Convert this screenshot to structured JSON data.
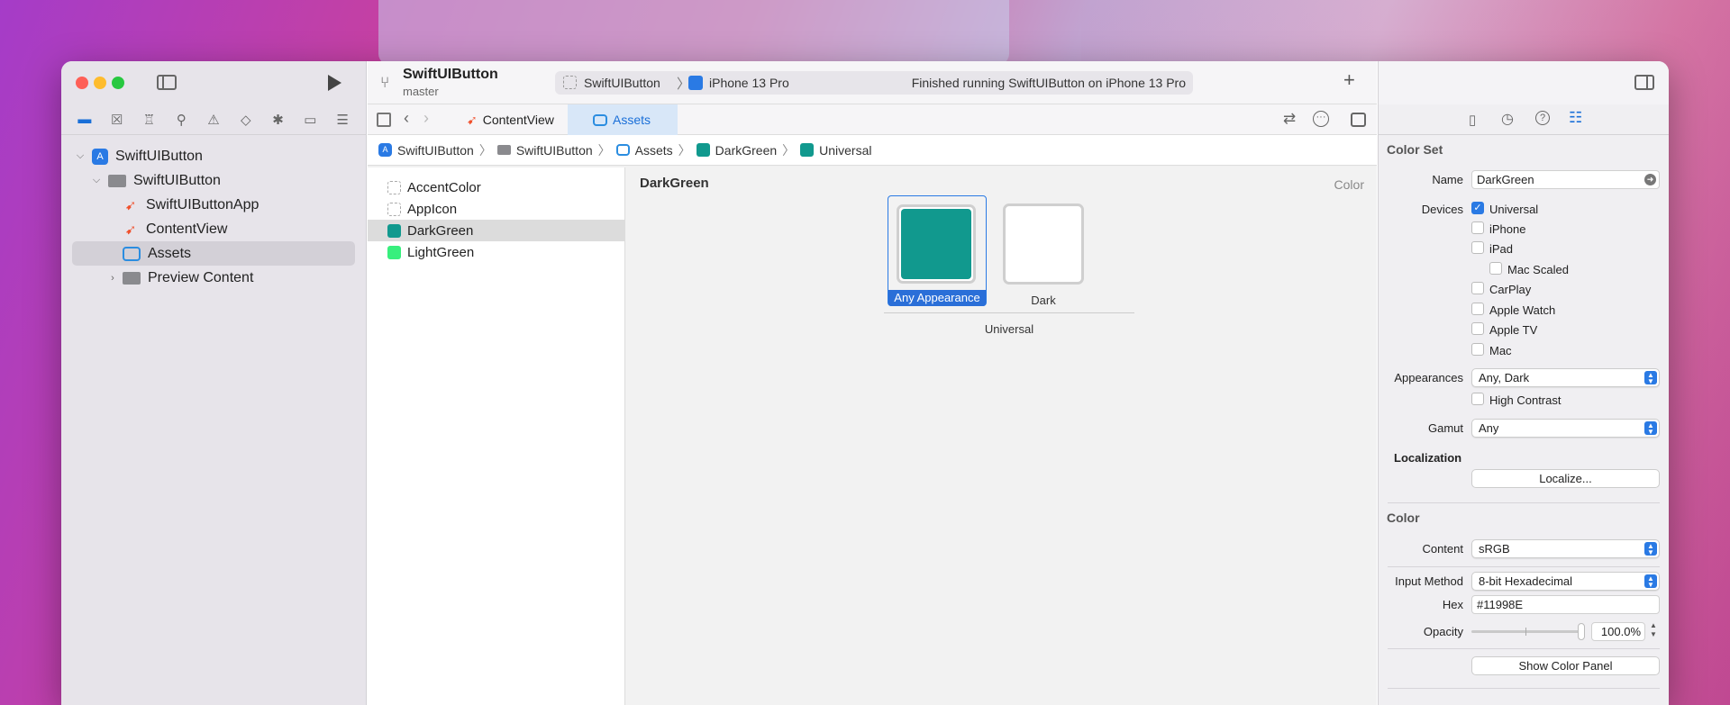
{
  "project": {
    "name": "SwiftUIButton",
    "branch": "master"
  },
  "toolbar": {
    "scheme": "SwiftUIButton",
    "device": "iPhone 13 Pro",
    "status": "Finished running SwiftUIButton on iPhone 13 Pro"
  },
  "navigator": {
    "items": [
      {
        "label": "SwiftUIButton",
        "icon": "app-icon"
      },
      {
        "label": "SwiftUIButton",
        "icon": "folder-icon"
      },
      {
        "label": "SwiftUIButtonApp",
        "icon": "swift-file-icon"
      },
      {
        "label": "ContentView",
        "icon": "swift-file-icon"
      },
      {
        "label": "Assets",
        "icon": "assets-icon"
      },
      {
        "label": "Preview Content",
        "icon": "folder-icon"
      }
    ]
  },
  "tabs": [
    {
      "label": "ContentView"
    },
    {
      "label": "Assets"
    }
  ],
  "breadcrumb": [
    "SwiftUIButton",
    "SwiftUIButton",
    "Assets",
    "DarkGreen",
    "Universal"
  ],
  "assets": [
    {
      "label": "AccentColor"
    },
    {
      "label": "AppIcon"
    },
    {
      "label": "DarkGreen"
    },
    {
      "label": "LightGreen"
    }
  ],
  "editor": {
    "title": "DarkGreen",
    "kind": "Color",
    "slot_any": "Any Appearance",
    "slot_dark": "Dark",
    "group": "Universal"
  },
  "inspector": {
    "color_set_header": "Color Set",
    "name_label": "Name",
    "name_value": "DarkGreen",
    "devices_label": "Devices",
    "devices": [
      "Universal",
      "iPhone",
      "iPad",
      "Mac Scaled",
      "CarPlay",
      "Apple Watch",
      "Apple TV",
      "Mac"
    ],
    "appearances_label": "Appearances",
    "appearances_value": "Any, Dark",
    "high_contrast": "High Contrast",
    "gamut_label": "Gamut",
    "gamut_value": "Any",
    "localization_header": "Localization",
    "localize_button": "Localize...",
    "color_header": "Color",
    "content_label": "Content",
    "content_value": "sRGB",
    "input_method_label": "Input Method",
    "input_method_value": "8-bit Hexadecimal",
    "hex_label": "Hex",
    "hex_value": "#11998E",
    "opacity_label": "Opacity",
    "opacity_value": "100.0%",
    "show_color_panel": "Show Color Panel"
  },
  "colors": {
    "dark_green": "#11998E",
    "light_green": "#38EF7D",
    "accent": "#2A7AE4"
  }
}
